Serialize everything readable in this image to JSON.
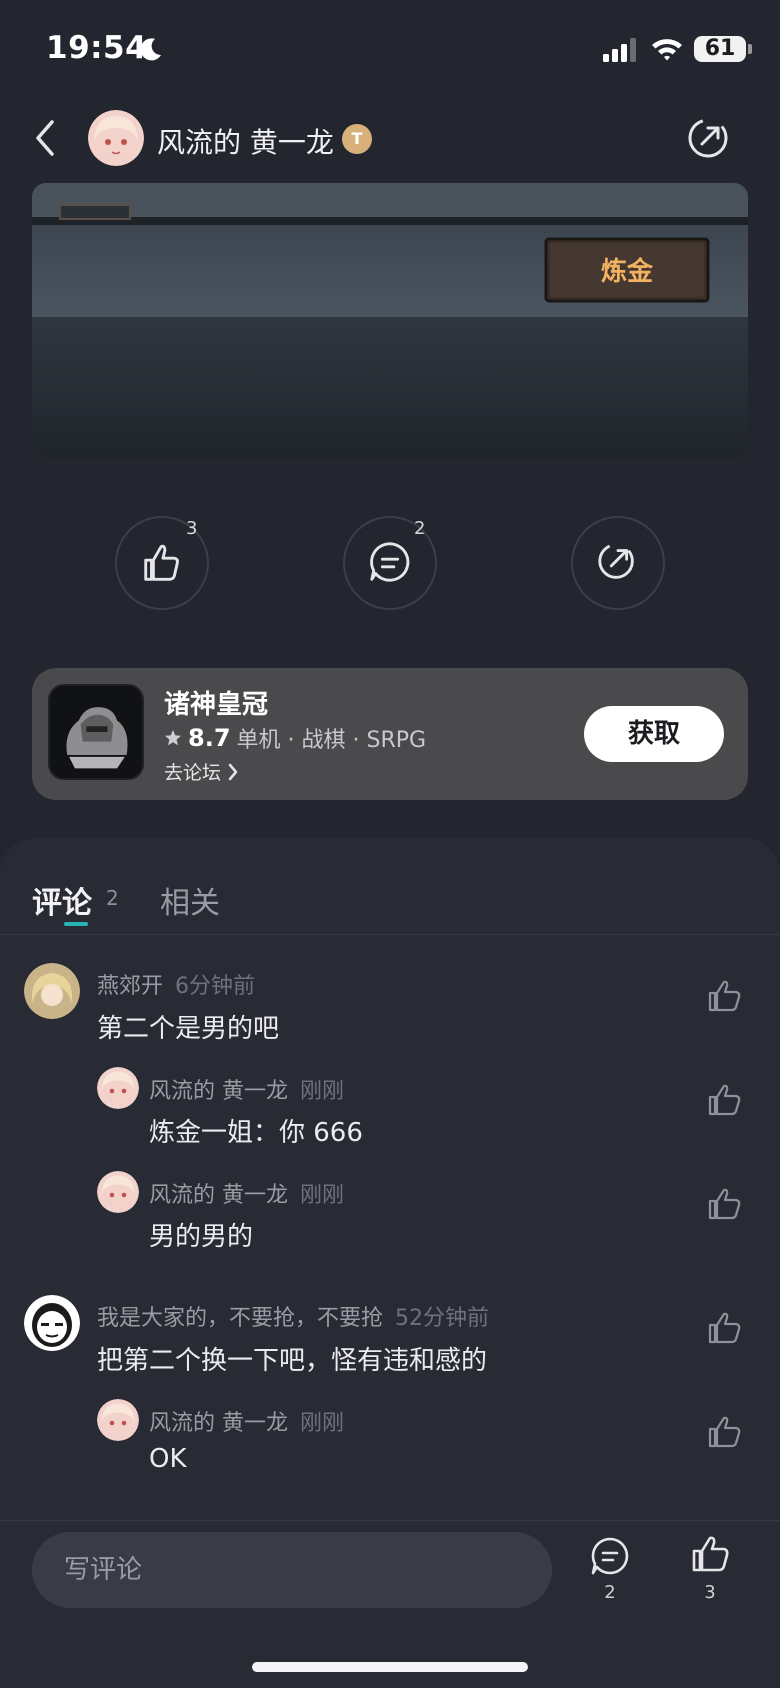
{
  "status_bar": {
    "time": "19:54",
    "battery": "61"
  },
  "header": {
    "author_name": "风流的 黄一龙",
    "badge_text": "T"
  },
  "post": {
    "sign_text": "炼金"
  },
  "actions": {
    "like_count": "3",
    "comment_count": "2"
  },
  "game_card": {
    "name": "诸神皇冠",
    "rating": "8.7",
    "tags": "单机 · 战棋 · SRPG",
    "forum_link": "去论坛",
    "get_label": "获取"
  },
  "tabs": {
    "comments_label": "评论",
    "comments_count": "2",
    "related_label": "相关"
  },
  "comments": [
    {
      "user": "燕郊开",
      "time": "6分钟前",
      "text": "第二个是男的吧"
    },
    {
      "user": "风流的 黄一龙",
      "time": "刚刚",
      "text": "炼金一姐：你 666"
    },
    {
      "user": "风流的 黄一龙",
      "time": "刚刚",
      "text": "男的男的"
    },
    {
      "user": "我是大家的，不要抢，不要抢",
      "time": "52分钟前",
      "text": "把第二个换一下吧，怪有违和感的"
    },
    {
      "user": "风流的 黄一龙",
      "time": "刚刚",
      "text": "OK"
    }
  ],
  "bottom_bar": {
    "input_placeholder": "写评论",
    "comment_count": "2",
    "like_count": "3"
  },
  "colors": {
    "background": "#24262f",
    "panel": "#282a34",
    "accent": "#26b4b6",
    "card": "#4a4a4c"
  }
}
